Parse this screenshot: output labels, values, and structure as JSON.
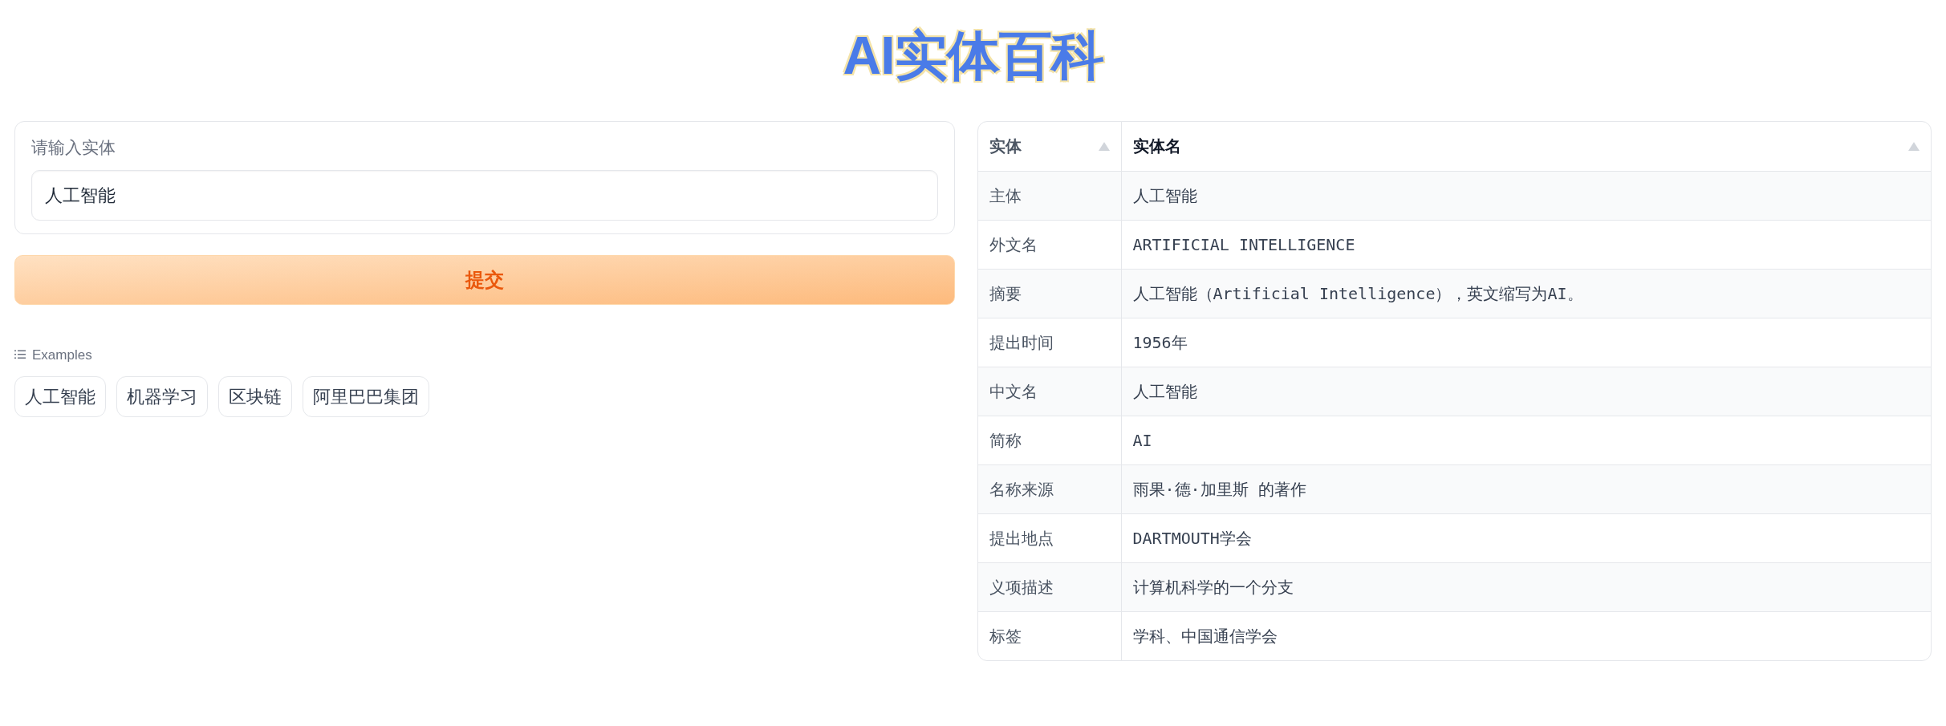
{
  "title": "AI实体百科",
  "input": {
    "label": "请输入实体",
    "value": "人工智能"
  },
  "submit_button": "提交",
  "examples": {
    "label": "Examples",
    "items": [
      "人工智能",
      "机器学习",
      "区块链",
      "阿里巴巴集团"
    ]
  },
  "table": {
    "columns": [
      "实体",
      "实体名"
    ],
    "rows": [
      [
        "主体",
        "人工智能"
      ],
      [
        "外文名",
        "ARTIFICIAL INTELLIGENCE"
      ],
      [
        "摘要",
        "人工智能（Artificial Intelligence），英文缩写为AI。"
      ],
      [
        "提出时间",
        "1956年"
      ],
      [
        "中文名",
        "人工智能"
      ],
      [
        "简称",
        "AI"
      ],
      [
        "名称来源",
        "雨果·德·加里斯 的著作"
      ],
      [
        "提出地点",
        "DARTMOUTH学会"
      ],
      [
        "义项描述",
        "计算机科学的一个分支"
      ],
      [
        "标签",
        "学科、中国通信学会"
      ]
    ]
  }
}
